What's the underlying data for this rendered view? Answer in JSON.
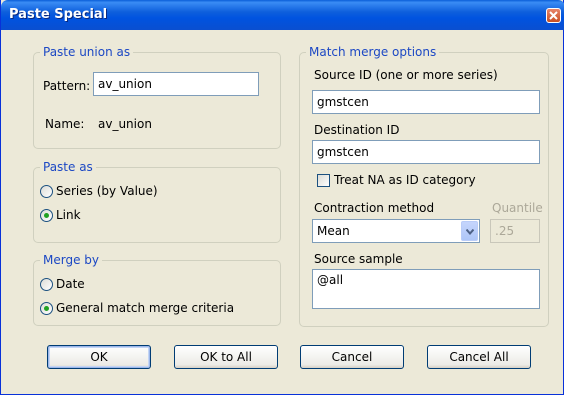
{
  "window": {
    "title": "Paste Special"
  },
  "paste_union": {
    "legend": "Paste union as",
    "pattern_label": "Pattern:",
    "pattern_value": "av_union",
    "name_label": "Name:",
    "name_value": "av_union"
  },
  "paste_as": {
    "legend": "Paste as",
    "options": [
      {
        "label": "Series (by Value)",
        "selected": false
      },
      {
        "label": "Link",
        "selected": true
      }
    ]
  },
  "merge_by": {
    "legend": "Merge by",
    "options": [
      {
        "label": "Date",
        "selected": false
      },
      {
        "label": "General match merge criteria",
        "selected": true
      }
    ]
  },
  "match_merge": {
    "legend": "Match merge options",
    "source_id_label": "Source ID (one or more series)",
    "source_id_value": "gmstcen",
    "destination_id_label": "Destination ID",
    "destination_id_value": "gmstcen",
    "treat_na_label": "Treat NA as ID category",
    "treat_na_checked": false,
    "contraction_label": "Contraction method",
    "contraction_value": "Mean",
    "quantile_label": "Quantile",
    "quantile_value": ".25",
    "source_sample_label": "Source sample",
    "source_sample_value": "@all"
  },
  "buttons": {
    "ok": "OK",
    "ok_to_all": "OK to All",
    "cancel": "Cancel",
    "cancel_all": "Cancel All"
  },
  "colors": {
    "titlebar": "#0053e0",
    "group_label": "#1c48c4",
    "dialog_bg": "#ece9d8"
  }
}
